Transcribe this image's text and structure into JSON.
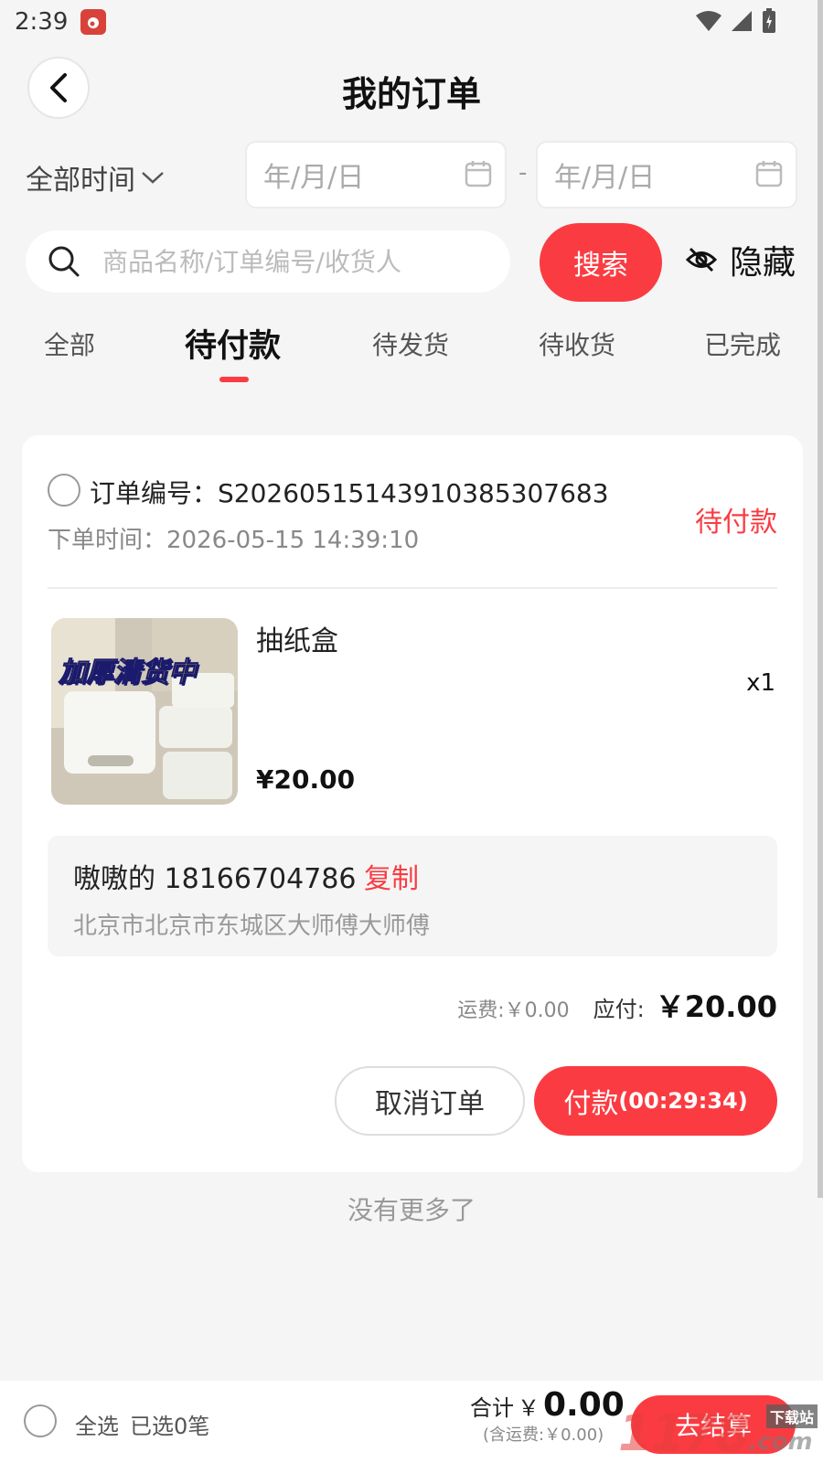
{
  "status_bar": {
    "time": "2:39"
  },
  "header": {
    "title": "我的订单"
  },
  "filters": {
    "time_range": "全部时间",
    "date_start_placeholder": "年/月/日",
    "date_end_placeholder": "年/月/日",
    "date_separator": "-"
  },
  "search": {
    "placeholder": "商品名称/订单编号/收货人",
    "button_label": "搜索",
    "hide_label": "隐藏"
  },
  "tabs": [
    {
      "label": "全部"
    },
    {
      "label": "待付款",
      "active": true
    },
    {
      "label": "待发货"
    },
    {
      "label": "待收货"
    },
    {
      "label": "已完成"
    }
  ],
  "order": {
    "number_label": "订单编号：",
    "number": "S2026051514391038530768З",
    "time_label": "下单时间：",
    "time": "2026-05-15 14:39:10",
    "status": "待付款",
    "product": {
      "name": "抽纸盒",
      "quantity": "x1",
      "price": "¥20.00",
      "image_text": "加厚清货中"
    },
    "address": {
      "name_phone": "嗷嗷的 18166704786",
      "copy_label": "复制",
      "line": "北京市北京市东城区大师傅大师傅"
    },
    "shipping_fee": "运费:￥0.00",
    "due_label": "应付:",
    "due_value": "￥20.00",
    "cancel_label": "取消订单",
    "pay_label": "付款",
    "pay_countdown": "(00:29:34)"
  },
  "list_footer": "没有更多了",
  "bottom_bar": {
    "select_all": "全选",
    "selected_count": "已选0笔",
    "total_label": "合计",
    "total_currency": "￥",
    "total_value": "0.00",
    "total_shipping": "(含运费:￥0.00)",
    "checkout_label": "去结算"
  },
  "watermark": {
    "brand": "1178",
    "suffix": ".com",
    "tag": "下载站"
  },
  "colors": {
    "accent": "#fa3c42",
    "background": "#f5f5f5"
  }
}
